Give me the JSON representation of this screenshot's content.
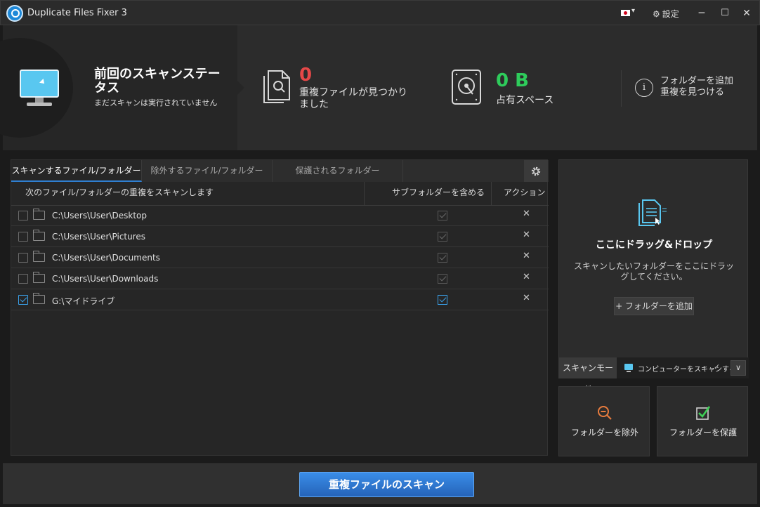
{
  "window": {
    "title": "Duplicate Files Fixer 3",
    "settings_label": "設定",
    "minimize": "─",
    "maximize": "☐",
    "close": "✕",
    "language_flag": "japan-flag"
  },
  "status": {
    "title": "前回のスキャンステータス",
    "subtitle": "まだスキャンは実行されていません",
    "duplicates_count": "0",
    "duplicates_label": "重複ファイルが見つかりました",
    "space_value": "0 B",
    "space_label": "占有スペース",
    "info_line1": "フォルダーを追加",
    "info_line2": "重複を見つける",
    "colors": {
      "duplicates": "#e54848",
      "space": "#2ecc5b"
    }
  },
  "tabs": [
    {
      "label": "スキャンするファイル/フォルダー",
      "active": true
    },
    {
      "label": "除外するファイル/フォルダー",
      "active": false
    },
    {
      "label": "保護されるフォルダー",
      "active": false
    }
  ],
  "table": {
    "columns": [
      "次のファイル/フォルダーの重複をスキャンします",
      "サブフォルダーを含める",
      "アクション"
    ],
    "rows": [
      {
        "path": "C:\\Users\\User\\Desktop",
        "checked": false,
        "include_subfolders": true
      },
      {
        "path": "C:\\Users\\User\\Pictures",
        "checked": false,
        "include_subfolders": true
      },
      {
        "path": "C:\\Users\\User\\Documents",
        "checked": false,
        "include_subfolders": true
      },
      {
        "path": "C:\\Users\\User\\Downloads",
        "checked": false,
        "include_subfolders": true
      },
      {
        "path": "G:\\マイドライブ",
        "checked": true,
        "include_subfolders": true
      }
    ],
    "remove_glyph": "✕"
  },
  "drop_zone": {
    "title": "ここにドラッグ&ドロップ",
    "description": "スキャンしたいフォルダーをここにドラッグしてください。",
    "add_button": "+ フォルダーを追加"
  },
  "scan_mode": {
    "label": "スキャンモード",
    "value": "コンピューターをスキャンする",
    "check_glyph": "✓",
    "dropdown_glyph": "∨"
  },
  "actions": {
    "exclude_label": "フォルダーを除外",
    "protect_label": "フォルダーを保護"
  },
  "scan_button": "重複ファイルのスキャン"
}
